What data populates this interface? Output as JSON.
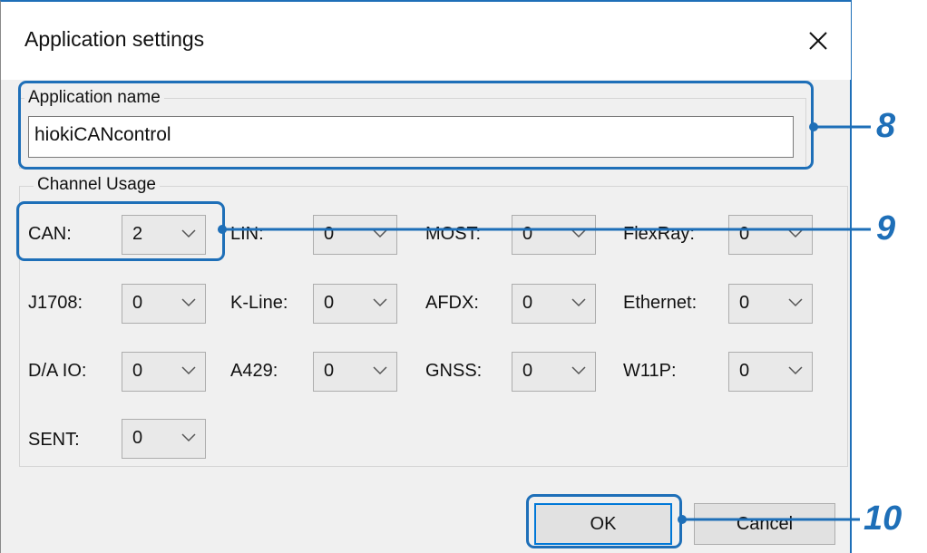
{
  "dialog": {
    "title": "Application settings",
    "close_icon": "close-icon"
  },
  "app_name": {
    "group_label": "Application name",
    "value": "hiokiCANcontrol"
  },
  "channel_usage": {
    "group_label": "Channel Usage",
    "rows": [
      [
        {
          "label": "CAN:",
          "value": "2"
        },
        {
          "label": "LIN:",
          "value": "0"
        },
        {
          "label": "MOST:",
          "value": "0"
        },
        {
          "label": "FlexRay:",
          "value": "0"
        }
      ],
      [
        {
          "label": "J1708:",
          "value": "0"
        },
        {
          "label": "K-Line:",
          "value": "0"
        },
        {
          "label": "AFDX:",
          "value": "0"
        },
        {
          "label": "Ethernet:",
          "value": "0"
        }
      ],
      [
        {
          "label": "D/A IO:",
          "value": "0"
        },
        {
          "label": "A429:",
          "value": "0"
        },
        {
          "label": "GNSS:",
          "value": "0"
        },
        {
          "label": "W11P:",
          "value": "0"
        }
      ],
      [
        {
          "label": "SENT:",
          "value": "0"
        }
      ]
    ]
  },
  "buttons": {
    "ok": "OK",
    "cancel": "Cancel"
  },
  "callouts": [
    "8",
    "9",
    "10"
  ],
  "colors": {
    "callout": "#1e6fb8",
    "dialog_bg": "#f0f0f0",
    "ok_focus": "#0078d7"
  }
}
